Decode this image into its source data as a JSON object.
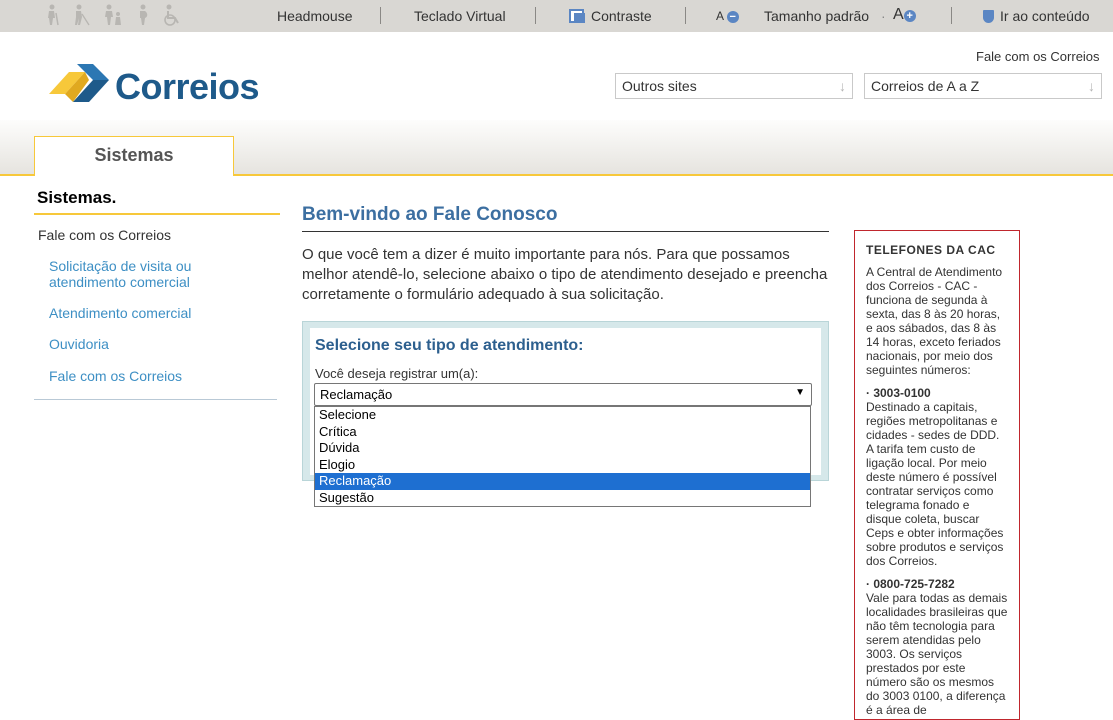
{
  "topbar": {
    "headmouse": "Headmouse",
    "virtual_keyboard": "Teclado Virtual",
    "contrast": "Contraste",
    "font_small": "A",
    "font_default": "Tamanho padrão",
    "font_large": "A",
    "skip_content": "Ir ao conteúdo"
  },
  "header": {
    "logo_text": "Correios",
    "contact_link": "Fale com os Correios",
    "other_sites": "Outros sites",
    "az_select": "Correios de A a Z"
  },
  "tabs": {
    "active": "Sistemas"
  },
  "sidebar": {
    "title": "Sistemas.",
    "heading": "Fale com os Correios",
    "links": [
      "Solicitação de visita ou atendimento comercial",
      "Atendimento comercial",
      "Ouvidoria",
      "Fale com os Correios"
    ]
  },
  "main": {
    "title": "Bem-vindo ao Fale Conosco",
    "intro": "O que você tem a dizer é muito importante para nós. Para que possamos melhor atendê-lo, selecione abaixo o tipo de atendimento desejado e preencha corretamente o formulário adequado à sua solicitação.",
    "form_title": "Selecione seu tipo de atendimento:",
    "form_label": "Você deseja registrar um(a):",
    "selected_value": "Reclamação",
    "options": [
      "Selecione",
      "Crítica",
      "Dúvida",
      "Elogio",
      "Reclamação",
      "Sugestão"
    ]
  },
  "phones": {
    "title": "TELEFONES DA CAC",
    "intro": "A Central de Atendimento dos Correios - CAC - funciona de segunda à sexta, das 8 às 20 horas, e aos sábados, das 8 às 14 horas, exceto feriados nacionais, por meio dos seguintes números:",
    "number1": "· 3003-0100",
    "text1": "Destinado a capitais, regiões metropolitanas e cidades - sedes de DDD. A tarifa tem custo de ligação local. Por meio deste número é possível contratar serviços como telegrama fonado e disque coleta, buscar Ceps e obter informações sobre produtos e serviços dos Correios.",
    "number2": "· 0800-725-7282",
    "text2": "Vale para todas as demais localidades brasileiras que não têm tecnologia para serem atendidas pelo 3003. Os serviços prestados por este número são os mesmos do 3003 0100, a diferença é a área de"
  },
  "colors": {
    "brand_blue": "#1e5a8a",
    "accent_yellow": "#f7c83a",
    "link_blue": "#3d8fc4",
    "phone_border": "#c0262d",
    "selected_option": "#1e6fd1"
  }
}
